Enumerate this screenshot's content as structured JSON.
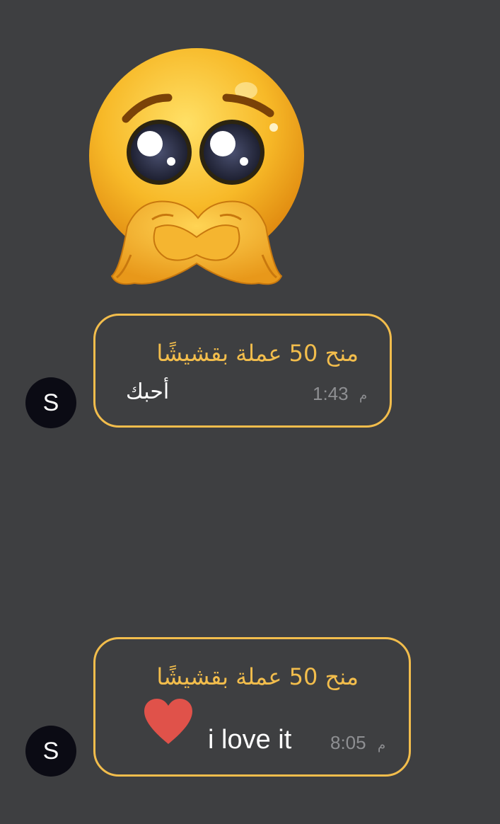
{
  "messages": [
    {
      "avatar_letter": "S",
      "gift_text": "منح 50 عملة بقشيشًا",
      "body": "أحبك",
      "time": "1:43",
      "time_suffix": "م"
    },
    {
      "avatar_letter": "S",
      "gift_text": "منح 50 عملة بقشيشًا",
      "body": "i love it",
      "time": "8:05",
      "time_suffix": "م",
      "icon": "red-heart-icon"
    }
  ],
  "sticker": {
    "icon": "pleading-face-heart-hands-sticker"
  },
  "colors": {
    "background": "#3e3f41",
    "bubble_border": "#f2bd4c",
    "gift_text": "#f2bd4c",
    "body_text": "#ffffff",
    "time_text": "#8e8f92",
    "avatar_bg": "#0b0b14",
    "heart": "#e0524a"
  }
}
